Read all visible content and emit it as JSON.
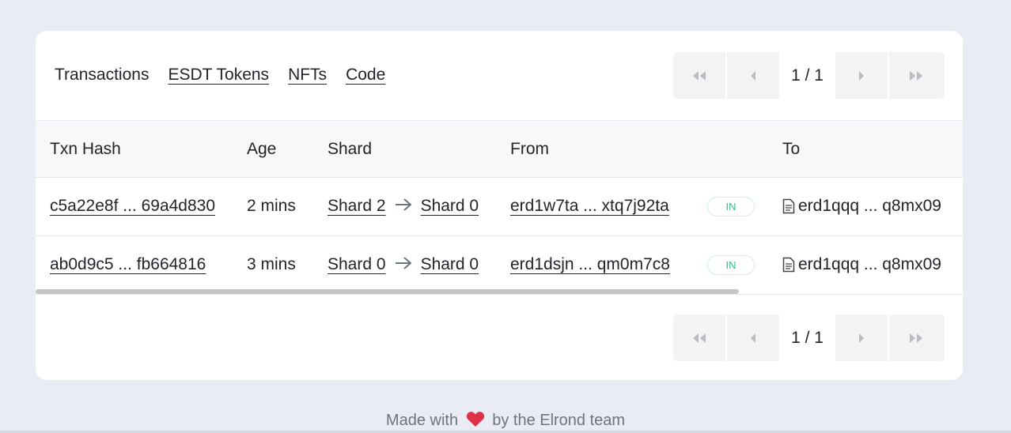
{
  "tabs": {
    "transactions": "Transactions",
    "esdt_tokens": "ESDT Tokens",
    "nfts": "NFTs",
    "code": "Code"
  },
  "pager": {
    "label": "1 / 1",
    "icons": [
      "first-page-icon",
      "prev-page-icon",
      "next-page-icon",
      "last-page-icon"
    ]
  },
  "table": {
    "headers": {
      "hash": "Txn Hash",
      "age": "Age",
      "shard": "Shard",
      "from": "From",
      "to": "To"
    },
    "rows": [
      {
        "hash": "c5a22e8f ... 69a4d830",
        "age": "2 mins",
        "shard_from": "Shard 2",
        "shard_to": "Shard 0",
        "from": "erd1w7ta ... xtq7j92ta",
        "direction": "IN",
        "to": "erd1qqq ... q8mx09"
      },
      {
        "hash": "ab0d9c5 ... fb664816",
        "age": "3 mins",
        "shard_from": "Shard 0",
        "shard_to": "Shard 0",
        "from": "erd1dsjn ... qm0m7c8",
        "direction": "IN",
        "to": "erd1qqq ... q8mx09"
      }
    ]
  },
  "footer": {
    "before": "Made with",
    "after": "by the Elrond team"
  },
  "colors": {
    "background": "#e9ebf5",
    "badge_in": "#2bc37e",
    "heart": "#e0314b"
  }
}
